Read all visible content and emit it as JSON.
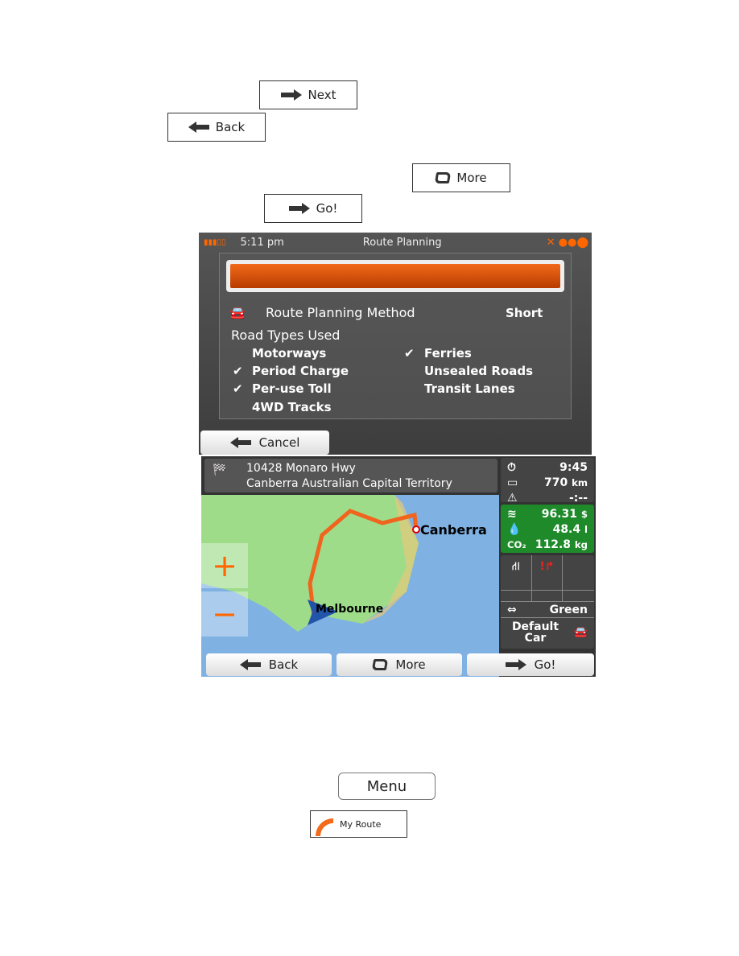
{
  "doc_buttons": {
    "next": "Next",
    "back": "Back",
    "more": "More",
    "go": "Go!",
    "menu": "Menu",
    "my_route": "My Route"
  },
  "screen1": {
    "time": "5:11 pm",
    "title": "Route Planning",
    "method_label": "Route Planning Method",
    "method_value": "Short",
    "road_types_label": "Road Types Used",
    "road_types": [
      {
        "label": "Motorways",
        "checked": false
      },
      {
        "label": "Period Charge",
        "checked": true
      },
      {
        "label": "Per-use Toll",
        "checked": true
      },
      {
        "label": "4WD Tracks",
        "checked": false
      },
      {
        "label": "Ferries",
        "checked": true
      },
      {
        "label": "Unsealed Roads",
        "checked": false
      },
      {
        "label": "Transit Lanes",
        "checked": false
      }
    ],
    "cancel": "Cancel",
    "progress_color": "#e05a10"
  },
  "screen2": {
    "address_line1": "10428 Monaro Hwy",
    "address_line2": "Canberra Australian Capital Territory",
    "eta": "9:45",
    "distance": "770",
    "distance_unit": "km",
    "delay": "-:--",
    "cost": "96.31",
    "cost_unit": "$",
    "fuel": "48.4",
    "fuel_unit": "l",
    "co2_label": "CO₂",
    "co2": "112.8",
    "co2_unit": "kg",
    "route_type": "Green",
    "vehicle": "Default Car",
    "city_dest": "Canberra",
    "city_origin": "Melbourne",
    "back": "Back",
    "more": "More",
    "go": "Go!",
    "route_color": "#f0641e"
  }
}
